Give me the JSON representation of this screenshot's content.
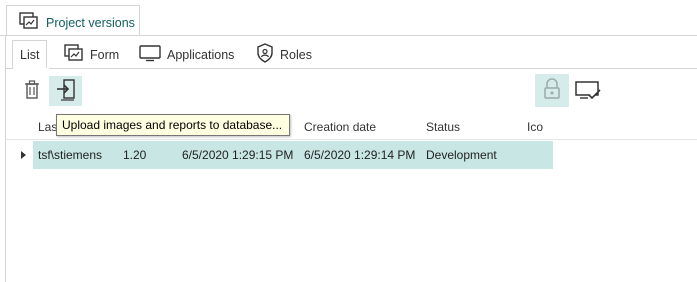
{
  "window": {
    "tab_title": "Project versions"
  },
  "subtabs": [
    {
      "label": "List",
      "active": true
    },
    {
      "label": "Form",
      "active": false
    },
    {
      "label": "Applications",
      "active": false
    },
    {
      "label": "Roles",
      "active": false
    }
  ],
  "toolbar": {
    "delete_icon": "trash-icon",
    "upload_icon": "upload-to-database-icon",
    "lock_icon": "lock-icon",
    "check_icon": "screen-check-icon"
  },
  "tooltip": {
    "text": "Upload images and reports to database..."
  },
  "table": {
    "columns": [
      "Las",
      "Creation date",
      "Status",
      "Ico"
    ],
    "rows": [
      {
        "user": "tsf\\stiemens",
        "version": "1.20",
        "modified": "6/5/2020 1:29:15 PM",
        "created": "6/5/2020 1:29:14 PM",
        "status": "Development"
      }
    ]
  },
  "colors": {
    "accent_text": "#11605f",
    "selection": "#c8e6e3",
    "hover": "#d6ecea"
  }
}
